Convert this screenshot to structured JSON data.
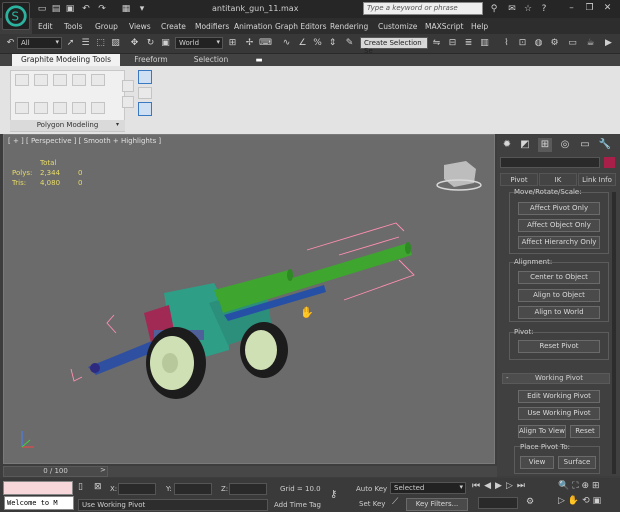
{
  "window": {
    "title": "antitank_gun_11.max"
  },
  "search": {
    "placeholder": "Type a keyword or phrase"
  },
  "menu": [
    "Edit",
    "Tools",
    "Group",
    "Views",
    "Create",
    "Modifiers",
    "Animation",
    "Graph Editors",
    "Rendering",
    "Customize",
    "MAXScript",
    "Help"
  ],
  "toolbar": {
    "filter_value": "All",
    "coord_value": "World",
    "selection_set": "Create Selection Se"
  },
  "ribbon": {
    "tabs": [
      "Graphite Modeling Tools",
      "Freeform",
      "Selection"
    ],
    "group_label": "Polygon Modeling"
  },
  "viewport": {
    "label": "[ + ] [ Perspective ] [ Smooth + Highlights ]",
    "stats_header": "Total",
    "polys_label": "Polys:",
    "polys_total": "2,344",
    "polys_sel": "0",
    "tris_label": "Tris:",
    "tris_total": "4,080",
    "tris_sel": "0"
  },
  "command_panel": {
    "tabs": [
      "Pivot",
      "IK",
      "Link Info"
    ],
    "move_rotate_scale_label": "Move/Rotate/Scale:",
    "affect_pivot_only": "Affect Pivot Only",
    "affect_object_only": "Affect Object Only",
    "affect_hierarchy_only": "Affect Hierarchy Only",
    "alignment_label": "Alignment:",
    "center_to_object": "Center to Object",
    "align_to_object": "Align to Object",
    "align_to_world": "Align to World",
    "pivot_label": "Pivot:",
    "reset_pivot": "Reset Pivot",
    "working_pivot_header": "Working Pivot",
    "edit_working_pivot": "Edit Working Pivot",
    "use_working_pivot": "Use Working Pivot",
    "align_to_view": "Align To View",
    "reset": "Reset",
    "place_pivot_to": "Place Pivot To:",
    "view": "View",
    "surface": "Surface",
    "minus": "-"
  },
  "timeline": {
    "value": "0 / 100"
  },
  "status": {
    "welcome": "Welcome to M",
    "prompt": "Use Working Pivot",
    "x_label": "X:",
    "y_label": "Y:",
    "z_label": "Z:",
    "grid": "Grid = 10.0",
    "auto_key": "Auto Key",
    "set_key": "Set Key",
    "selected": "Selected",
    "key_filters": "Key Filters...",
    "add_time_tag": "Add Time Tag"
  },
  "colors": {
    "barrel": "#3ea52f",
    "body": "#2e9e86",
    "wheel": "#cfe0b4",
    "viewport_bg": "#6b6b6b",
    "stats": "#e8dc6a"
  }
}
